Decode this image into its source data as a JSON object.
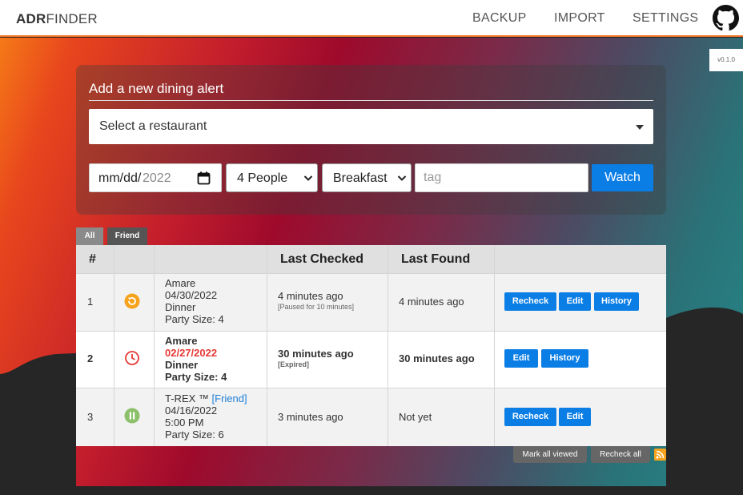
{
  "header": {
    "logo_bold": "ADR",
    "logo_rest": "FINDER",
    "nav": [
      "BACKUP",
      "IMPORT",
      "SETTINGS"
    ]
  },
  "version": "v0.1.0",
  "form": {
    "title": "Add a new dining alert",
    "restaurant_placeholder": "Select a restaurant",
    "date_md": "mm/dd/",
    "date_year": "2022",
    "party_size": "4 People",
    "meal": "Breakfast",
    "tag_placeholder": "tag",
    "watch_label": "Watch"
  },
  "tabs": [
    "All",
    "Friend"
  ],
  "table": {
    "headers": [
      "#",
      "",
      "",
      "Last Checked",
      "Last Found",
      ""
    ],
    "rows": [
      {
        "index": "1",
        "status_icon": "refresh-icon",
        "name": "Amare",
        "date": "04/30/2022",
        "meal": "Dinner",
        "party": "Party Size: 4",
        "last_checked": "4 minutes ago",
        "checked_note": "[Paused for 10 minutes]",
        "last_found": "4 minutes ago",
        "actions": [
          "Recheck",
          "Edit",
          "History"
        ]
      },
      {
        "index": "2",
        "status_icon": "clock-icon",
        "name": "Amare",
        "date": "02/27/2022",
        "meal": "Dinner",
        "party": "Party Size: 4",
        "last_checked": "30 minutes ago",
        "checked_note": "[Expired]",
        "last_found": "30 minutes ago",
        "actions": [
          "Edit",
          "History"
        ]
      },
      {
        "index": "3",
        "status_icon": "pause-icon",
        "name": "T-REX ™",
        "tag": "[Friend]",
        "date": "04/16/2022",
        "meal": "5:00 PM",
        "party": "Party Size: 6",
        "last_checked": "3 minutes ago",
        "last_found": "Not yet",
        "actions": [
          "Recheck",
          "Edit"
        ]
      }
    ]
  },
  "footer": {
    "mark_all": "Mark all viewed",
    "recheck_all": "Recheck all"
  },
  "colors": {
    "accent": "#0b7ee6",
    "header_border": "#f5792a",
    "expired_date": "#e53935",
    "refresh_icon": "#f7a21c",
    "clock_icon": "#e53935",
    "pause_icon": "#8cc06a"
  }
}
